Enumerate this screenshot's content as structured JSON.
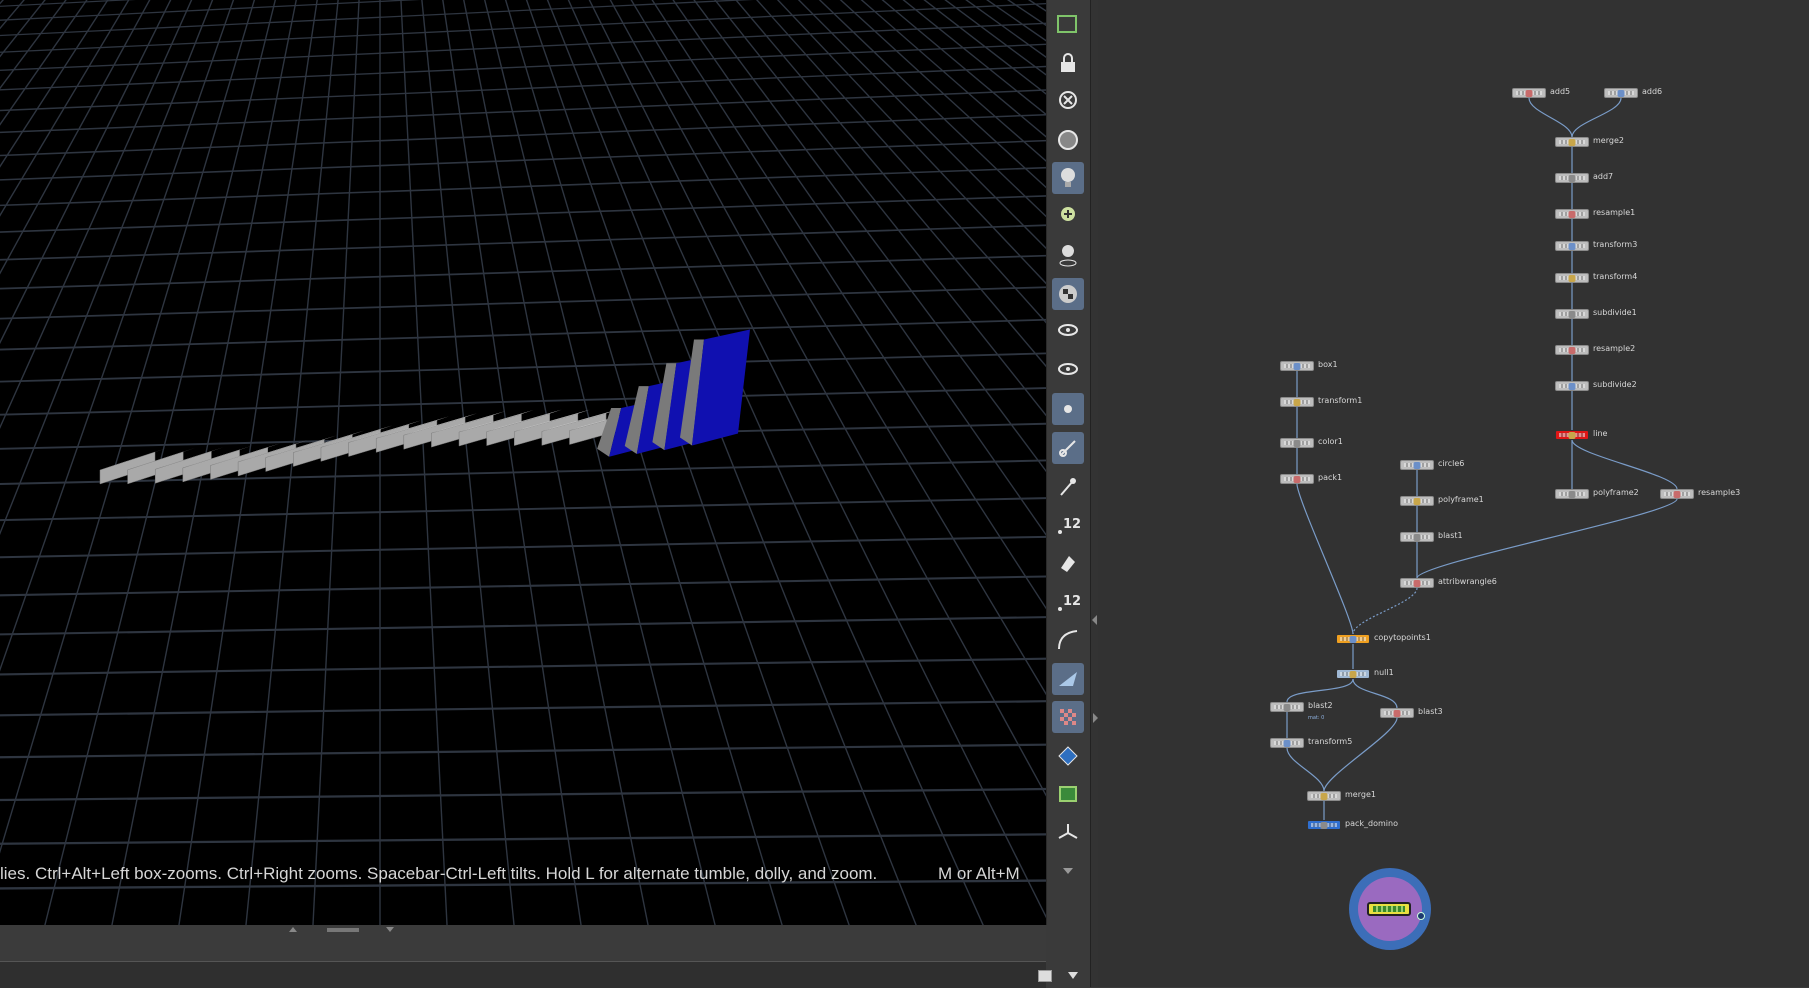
{
  "viewport": {
    "status_text": "lies. Ctrl+Alt+Left box-zooms. Ctrl+Right zooms. Spacebar-Ctrl-Left tilts. Hold L for alternate tumble, dolly, and zoom.",
    "hotkey_text": "M or Alt+M",
    "colors": {
      "background": "#000000",
      "grid": "#2e3540",
      "domino_face": "#a9a9a9",
      "domino_blue": "#1010b0"
    }
  },
  "toolbar": {
    "buttons": [
      {
        "icon": "view-icon",
        "active": false
      },
      {
        "icon": "lock-icon",
        "active": false
      },
      {
        "icon": "close-icon",
        "active": false
      },
      {
        "icon": "camera-icon",
        "active": false
      },
      {
        "icon": "light-bulb-icon",
        "active": true
      },
      {
        "icon": "add-light-icon",
        "active": false
      },
      {
        "icon": "spot-light-icon",
        "active": false
      },
      {
        "icon": "checker-sphere-icon",
        "active": true
      },
      {
        "icon": "display-eye-icon",
        "active": false
      },
      {
        "icon": "play-eye-icon",
        "active": false
      },
      {
        "icon": "point-icon",
        "active": true
      },
      {
        "icon": "brush-icon",
        "active": true
      },
      {
        "icon": "pin-icon",
        "active": false
      },
      {
        "icon": "point-number-icon",
        "active": false,
        "label": "12"
      },
      {
        "icon": "prim-icon",
        "active": false
      },
      {
        "icon": "prim-number-icon",
        "active": false,
        "label": "12"
      },
      {
        "icon": "curve-icon",
        "active": false
      },
      {
        "icon": "shade-icon",
        "active": true
      },
      {
        "icon": "texture-checker-icon",
        "active": true
      },
      {
        "icon": "diamond-icon",
        "active": false
      },
      {
        "icon": "frame-icon",
        "active": false
      },
      {
        "icon": "axis-icon",
        "active": false
      },
      {
        "icon": "more-arrow-icon",
        "active": false
      }
    ]
  },
  "network": {
    "nodes": [
      {
        "id": "add5",
        "label": "add5"
      },
      {
        "id": "add6",
        "label": "add6"
      },
      {
        "id": "merge2",
        "label": "merge2"
      },
      {
        "id": "add7",
        "label": "add7"
      },
      {
        "id": "resample1",
        "label": "resample1"
      },
      {
        "id": "transform3",
        "label": "transform3"
      },
      {
        "id": "transform4",
        "label": "transform4"
      },
      {
        "id": "subdivide1",
        "label": "subdivide1"
      },
      {
        "id": "resample2",
        "label": "resample2"
      },
      {
        "id": "subdivide2",
        "label": "subdivide2"
      },
      {
        "id": "line",
        "label": "line",
        "color": "#e01616"
      },
      {
        "id": "polyframe2",
        "label": "polyframe2"
      },
      {
        "id": "resample3",
        "label": "resample3"
      },
      {
        "id": "box1",
        "label": "box1"
      },
      {
        "id": "transform1",
        "label": "transform1"
      },
      {
        "id": "color1",
        "label": "color1"
      },
      {
        "id": "pack1",
        "label": "pack1"
      },
      {
        "id": "circle6",
        "label": "circle6"
      },
      {
        "id": "polyframe1",
        "label": "polyframe1"
      },
      {
        "id": "blast1",
        "label": "blast1"
      },
      {
        "id": "attribwrangle6",
        "label": "attribwrangle6"
      },
      {
        "id": "copytopoints1",
        "label": "copytopoints1",
        "color": "#f0a020"
      },
      {
        "id": "null1",
        "label": "null1",
        "color": "#9fb8d4"
      },
      {
        "id": "blast2",
        "label": "blast2",
        "sub": "mat: 0"
      },
      {
        "id": "blast3",
        "label": "blast3"
      },
      {
        "id": "transform5",
        "label": "transform5"
      },
      {
        "id": "merge1",
        "label": "merge1"
      },
      {
        "id": "pack_domino",
        "label": "pack_domino",
        "color": "#2f6fd0"
      }
    ]
  }
}
